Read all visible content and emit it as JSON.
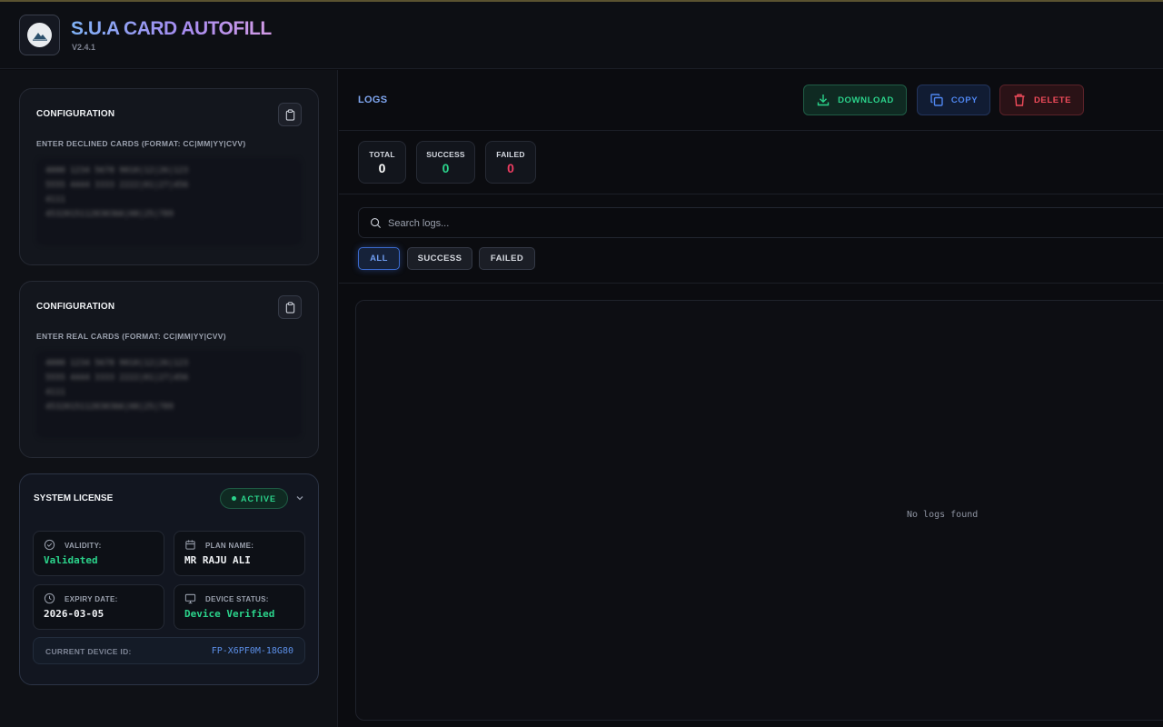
{
  "app": {
    "title": "S.U.A CARD AUTOFILL",
    "version": "V2.4.1",
    "logo_icon": "app-logo-icon"
  },
  "declined_section": {
    "title": "CONFIGURATION",
    "subtitle": "ENTER DECLINED CARDS (FORMAT: CC|MM|YY|CVV)",
    "clipboard_icon": "clipboard-icon",
    "placeholder": "4000 1234 5678 9010|12|26|123\n5555 4444 3333 2222|01|27|456\n4111\n4532015112830366|08|25|789"
  },
  "real_section": {
    "title": "CONFIGURATION",
    "subtitle": "ENTER REAL CARDS (FORMAT: CC|MM|YY|CVV)",
    "clipboard_icon": "clipboard-icon",
    "placeholder": "4000 1234 5678 9010|12|26|123\n5555 4444 3333 2222|01|27|456\n4111\n4532015112830366|08|25|789"
  },
  "license": {
    "title": "SYSTEM LICENSE",
    "status": "ACTIVE",
    "validity_label": "VALIDITY:",
    "validity_value": "Validated",
    "plan_label": "PLAN NAME:",
    "plan_value": "MR RAJU ALI",
    "expiry_label": "EXPIRY DATE:",
    "expiry_value": "2026-03-05",
    "device_label": "DEVICE STATUS:",
    "device_value": "Device Verified",
    "device_id_label": "CURRENT DEVICE ID:",
    "device_id_value": "FP-X6PF0M-18G80"
  },
  "logs": {
    "title": "LOGS",
    "download_label": "DOWNLOAD",
    "copy_label": "COPY",
    "delete_label": "DELETE",
    "stats": {
      "total_label": "TOTAL",
      "total_value": "0",
      "success_label": "SUCCESS",
      "success_value": "0",
      "failed_label": "FAILED",
      "failed_value": "0"
    },
    "search_placeholder": "Search logs...",
    "filters": {
      "all": "ALL",
      "success": "SUCCESS",
      "failed": "FAILED",
      "selected": "ALL"
    },
    "empty_message": "No logs found"
  },
  "colors": {
    "accent_blue": "#4f86f0",
    "success_green": "#2bd38b",
    "danger_red": "#ef4b5a",
    "background": "#0b0c10"
  }
}
